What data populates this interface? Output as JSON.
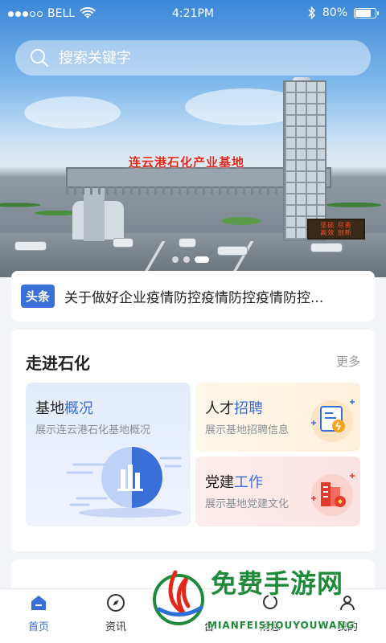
{
  "status_bar": {
    "carrier": "BELL",
    "time": "4:21PM",
    "battery": "80%",
    "battery_level": 0.8,
    "signal_dots_filled": 3,
    "signal_dots_total": 5
  },
  "search": {
    "placeholder": "搜索关键字"
  },
  "banner": {
    "gantry_text": "连云港石化产业基地",
    "sign_text_lines": [
      "坚硕 尽责",
      "高效 创新"
    ],
    "slide_count": 3,
    "active_slide": 3
  },
  "headline": {
    "tag": "头条",
    "text": "关于做好企业疫情防控疫情防控疫情防控..."
  },
  "section": {
    "title": "走进石化",
    "more": "更多",
    "cards": {
      "overview": {
        "title_a": "基地",
        "title_b": "概况",
        "desc": "展示连云港石化基地概况"
      },
      "talent": {
        "title_a": "人才",
        "title_b": "招聘",
        "desc": "展示基地招聘信息"
      },
      "party": {
        "title_a": "党建",
        "title_b": "工作",
        "desc": "展示基地党建文化"
      }
    }
  },
  "nav": {
    "items": [
      {
        "label": "首页",
        "icon": "home-icon",
        "active": true
      },
      {
        "label": "资讯",
        "icon": "compass-icon"
      },
      {
        "label": "台",
        "icon": "platform-icon"
      },
      {
        "label": "消息",
        "icon": "message-icon"
      },
      {
        "label": "我的",
        "icon": "user-icon"
      }
    ]
  },
  "watermark": {
    "title": "免费手游网",
    "subtitle": "MIANFEISHOUYOUWANG"
  },
  "colors": {
    "accent": "#3b6fd8",
    "watermark_green": "#1e8a3a",
    "gantry_red": "#e0281c"
  }
}
